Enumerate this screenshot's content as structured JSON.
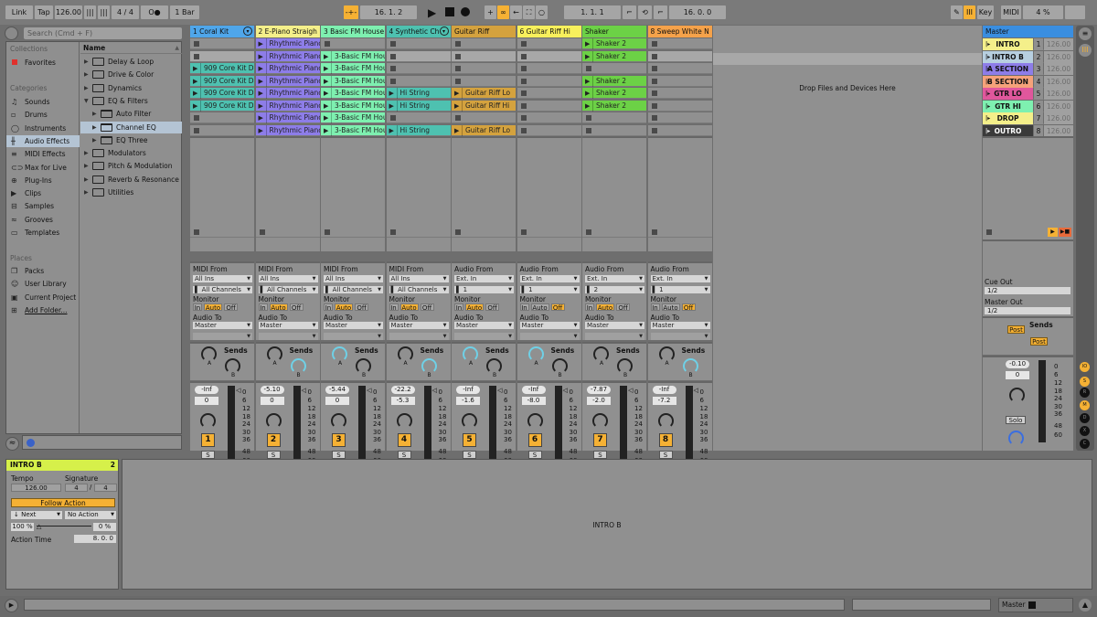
{
  "topbar": {
    "link": "Link",
    "tap": "Tap",
    "tempo": "126.00",
    "signature": "4 / 4",
    "metronome": "O●",
    "quantize": "1 Bar",
    "position": "16.  1.  2",
    "loop_start": "1.  1.  1",
    "loop_length": "16.  0.  0",
    "key": "Key",
    "midi": "MIDI",
    "cpu": "4 %",
    "colors": {
      "accent": "#f5b134"
    }
  },
  "browser": {
    "search_placeholder": "Search (Cmd + F)",
    "collections_label": "Collections",
    "favorites": "Favorites",
    "categories_label": "Categories",
    "categories": [
      "Sounds",
      "Drums",
      "Instruments",
      "Audio Effects",
      "MIDI Effects",
      "Max for Live",
      "Plug-Ins",
      "Clips",
      "Samples",
      "Grooves",
      "Templates"
    ],
    "category_icons": [
      "♫",
      "▫",
      "◯",
      "╫",
      "≡",
      "⊂⊃",
      "⊕",
      "▶",
      "⊟",
      "≈",
      "▭"
    ],
    "selected_category": "Audio Effects",
    "places_label": "Places",
    "places": [
      "Packs",
      "User Library",
      "Current Project",
      "Add Folder..."
    ],
    "name_header": "Name",
    "files": [
      {
        "name": "Delay & Loop",
        "level": 0,
        "open": false
      },
      {
        "name": "Drive & Color",
        "level": 0,
        "open": false
      },
      {
        "name": "Dynamics",
        "level": 0,
        "open": false
      },
      {
        "name": "EQ & Filters",
        "level": 0,
        "open": true
      },
      {
        "name": "Auto Filter",
        "level": 1,
        "open": false
      },
      {
        "name": "Channel EQ",
        "level": 1,
        "open": false,
        "selected": true
      },
      {
        "name": "EQ Three",
        "level": 1,
        "open": false
      },
      {
        "name": "Modulators",
        "level": 0,
        "open": false
      },
      {
        "name": "Pitch & Modulation",
        "level": 0,
        "open": false
      },
      {
        "name": "Reverb & Resonance",
        "level": 0,
        "open": false
      },
      {
        "name": "Utilities",
        "level": 0,
        "open": false
      }
    ]
  },
  "tracks": [
    {
      "name": "1 Coral Kit",
      "color": "#4fa6ea",
      "type": "midi",
      "clips": [
        null,
        null,
        "909 Core Kit Di",
        "909 Core Kit Di",
        "909 Core Kit Di",
        "909 Core Kit Di",
        null,
        null
      ],
      "clipcolor": "#4ec1b0",
      "from_label": "MIDI From",
      "from": "All Ins",
      "channel": "All Channels",
      "monitor": "Auto",
      "audio_to": "Master",
      "volume": "-Inf",
      "pan": "0",
      "sendA": "none",
      "sendB": "none",
      "number": "1"
    },
    {
      "name": "2 E-Piano Straigh",
      "color": "#f4ef8a",
      "type": "midi",
      "clips": [
        "Rhythmic Pianc",
        "Rhythmic Pianc",
        "Rhythmic Pianc",
        "Rhythmic Pianc",
        "Rhythmic Pianc",
        "Rhythmic Pianc",
        "Rhythmic Pianc",
        "Rhythmic Pianc"
      ],
      "clipcolor": "#8d7de8",
      "from_label": "MIDI From",
      "from": "All Ins",
      "channel": "All Channels",
      "monitor": "Auto",
      "audio_to": "Master",
      "volume": "-5.10",
      "pan": "0",
      "sendA": "none",
      "sendB": "blue",
      "number": "2"
    },
    {
      "name": "3 Basic FM House",
      "color": "#7ef0b0",
      "type": "midi",
      "clips": [
        null,
        "3-Basic FM Hou",
        "3-Basic FM Hou",
        "3-Basic FM Hou",
        "3-Basic FM Hou",
        "3-Basic FM Hou",
        "3-Basic FM Hou",
        "3-Basic FM Hou"
      ],
      "clipcolor": "#7ef0b0",
      "from_label": "MIDI From",
      "from": "All Ins",
      "channel": "All Channels",
      "monitor": "Auto",
      "audio_to": "Master",
      "volume": "-5.44",
      "pan": "0",
      "sendA": "blue",
      "sendB": "none",
      "number": "3"
    },
    {
      "name": "4 Synthetic Ch",
      "color": "#4ec1b0",
      "type": "midi",
      "clips": [
        null,
        null,
        null,
        null,
        "Hi String",
        "Hi String",
        null,
        "Hi String"
      ],
      "clipcolor": "#4ec1b0",
      "from_label": "MIDI From",
      "from": "All Ins",
      "channel": "All Channels",
      "monitor": "Auto",
      "audio_to": "Master",
      "volume": "-22.2",
      "pan": "-5.3",
      "sendA": "none",
      "sendB": "blue",
      "number": "4"
    },
    {
      "name": "Guitar Riff",
      "color": "#d4a23e",
      "type": "audio",
      "clips": [
        null,
        null,
        null,
        null,
        "Guitar Riff Lo",
        "Guitar Riff Hi",
        null,
        "Guitar Riff Lo"
      ],
      "clipcolor": "#d4a23e",
      "from_label": "Audio From",
      "from": "Ext. In",
      "channel": "1",
      "monitor": "Auto",
      "audio_to": "Master",
      "volume": "-Inf",
      "pan": "-1.6",
      "sendA": "blue",
      "sendB": "none",
      "number": "5"
    },
    {
      "name": "6 Guitar Riff Hi",
      "color": "#f8f05c",
      "type": "audio",
      "clips": [
        null,
        null,
        null,
        null,
        null,
        null,
        null,
        null
      ],
      "clipcolor": "#f8f05c",
      "from_label": "Audio From",
      "from": "Ext. In",
      "channel": "1",
      "monitor": "Off",
      "audio_to": "Master",
      "volume": "-Inf",
      "pan": "-8.0",
      "sendA": "blue",
      "sendB": "none",
      "number": "6"
    },
    {
      "name": "Shaker",
      "color": "#6cd146",
      "type": "audio",
      "clips": [
        "Shaker 2",
        "Shaker 2",
        null,
        "Shaker 2",
        "Shaker 2",
        "Shaker 2",
        null,
        null
      ],
      "clipcolor": "#6cd146",
      "from_label": "Audio From",
      "from": "Ext. In",
      "channel": "2",
      "monitor": "Auto",
      "audio_to": "Master",
      "volume": "-7.87",
      "pan": "-2.0",
      "sendA": "none",
      "sendB": "none",
      "number": "7"
    },
    {
      "name": "8 Sweep White N",
      "color": "#f5a24a",
      "type": "audio",
      "clips": [
        null,
        null,
        null,
        null,
        null,
        null,
        null,
        null
      ],
      "clipcolor": "#f5a24a",
      "from_label": "Audio From",
      "from": "Ext. In",
      "channel": "1",
      "monitor": "Off",
      "audio_to": "Master",
      "volume": "-Inf",
      "pan": "-7.2",
      "sendA": "none",
      "sendB": "blue",
      "number": "8"
    }
  ],
  "labels": {
    "monitor": "Monitor",
    "audio_to": "Audio To",
    "sends": "Sends",
    "in": "In",
    "auto": "Auto",
    "off": "Off",
    "solo_s": "S",
    "drop_here": "Drop Files and Devices Here",
    "meter_scale": [
      "0",
      "6",
      "12",
      "18",
      "24",
      "30",
      "36",
      "48",
      "60"
    ]
  },
  "master": {
    "name": "Master",
    "color": "#3a8ee0",
    "scenes": [
      {
        "name": "INTRO",
        "color": "#f4ef8a",
        "index": "1",
        "tempo": "126.00"
      },
      {
        "name": "INTRO B",
        "color": "#b7cfe0",
        "index": "2",
        "tempo": "126.00"
      },
      {
        "name": "A SECTION",
        "color": "#8d7de8",
        "index": "3",
        "tempo": "126.00"
      },
      {
        "name": "B SECTION",
        "color": "#f5a27a",
        "index": "4",
        "tempo": "126.00"
      },
      {
        "name": "GTR LO",
        "color": "#e0579c",
        "index": "5",
        "tempo": "126.00"
      },
      {
        "name": "GTR HI",
        "color": "#7ef0b0",
        "index": "6",
        "tempo": "126.00"
      },
      {
        "name": "DROP",
        "color": "#f4ef8a",
        "index": "7",
        "tempo": "126.00"
      },
      {
        "name": "OUTRO",
        "color": "#3a3a3a",
        "index": "8",
        "tempo": "126.00"
      }
    ],
    "cue_out_label": "Cue Out",
    "cue_out": "1/2",
    "master_out_label": "Master Out",
    "master_out": "1/2",
    "sends_label": "Sends",
    "post": "Post",
    "volume": "-0.10",
    "pan": "0",
    "solo": "Solo"
  },
  "clip_view": {
    "title": "INTRO B",
    "number": "2",
    "title_color": "#d6f04a",
    "tempo_label": "Tempo",
    "tempo": "126.00",
    "signature_label": "Signature",
    "sig_num": "4",
    "sig_den": "4",
    "follow_action": "Follow Action",
    "action_a": "Next",
    "action_b": "No Action",
    "chance_a": "100 %",
    "chance_b": "0 %",
    "action_time_label": "Action Time",
    "action_time": "8.  0.  0",
    "main_label": "INTRO B"
  },
  "statusbar": {
    "master_label": "Master"
  }
}
